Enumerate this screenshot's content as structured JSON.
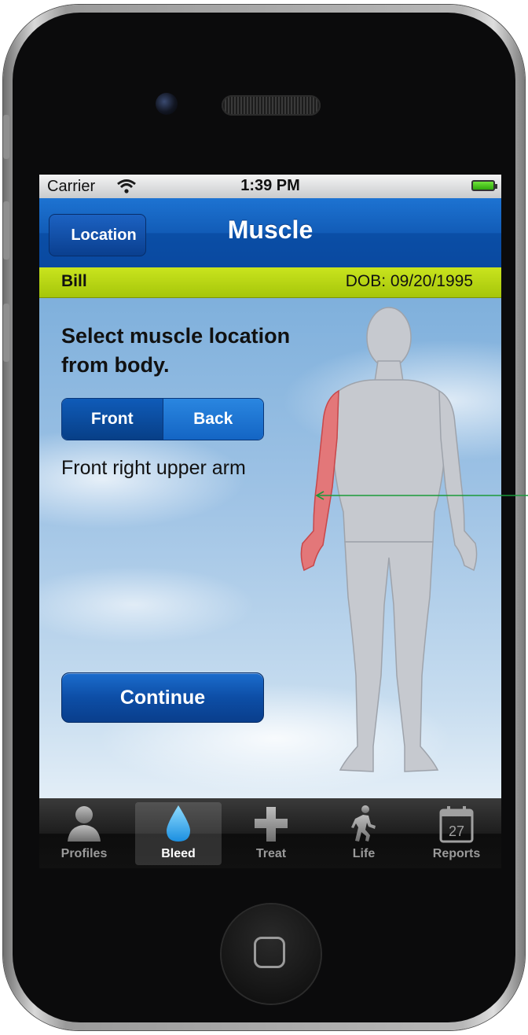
{
  "statusbar": {
    "carrier": "Carrier",
    "time": "1:39 PM"
  },
  "navbar": {
    "back_label": "Location",
    "title": "Muscle"
  },
  "patient": {
    "name": "Bill",
    "dob": "DOB: 09/20/1995"
  },
  "content": {
    "instructions": "Select muscle location from body.",
    "segments": [
      "Front",
      "Back"
    ],
    "selected_segment": "Front",
    "selected_location": "Front right upper arm",
    "continue_label": "Continue"
  },
  "tabbar": {
    "items": [
      {
        "label": "Profiles",
        "icon": "person-icon"
      },
      {
        "label": "Bleed",
        "icon": "drop-icon",
        "selected": true
      },
      {
        "label": "Treat",
        "icon": "plus-icon"
      },
      {
        "label": "Life",
        "icon": "walking-person-icon"
      },
      {
        "label": "Reports",
        "icon": "calendar-icon",
        "calendar_day": "27"
      }
    ]
  },
  "colors": {
    "navbar": "#125cb7",
    "patient_bar": "#b5d40f",
    "highlight_muscle": "#e8686a",
    "callout_arrow": "#1a9a3a"
  }
}
